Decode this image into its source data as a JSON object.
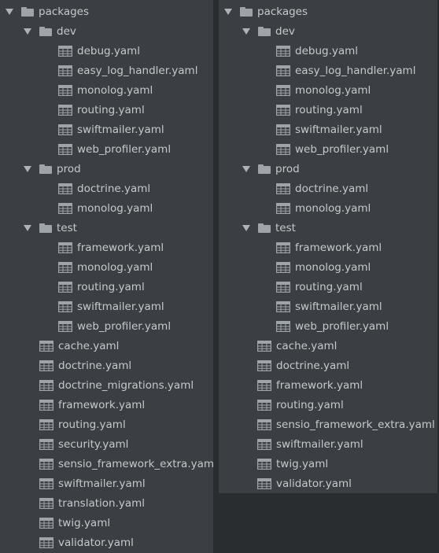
{
  "left_tree": [
    {
      "type": "folder",
      "depth": 0,
      "label": "packages"
    },
    {
      "type": "folder",
      "depth": 1,
      "label": "dev"
    },
    {
      "type": "file",
      "depth": 2,
      "label": "debug.yaml"
    },
    {
      "type": "file",
      "depth": 2,
      "label": "easy_log_handler.yaml"
    },
    {
      "type": "file",
      "depth": 2,
      "label": "monolog.yaml"
    },
    {
      "type": "file",
      "depth": 2,
      "label": "routing.yaml"
    },
    {
      "type": "file",
      "depth": 2,
      "label": "swiftmailer.yaml"
    },
    {
      "type": "file",
      "depth": 2,
      "label": "web_profiler.yaml"
    },
    {
      "type": "folder",
      "depth": 1,
      "label": "prod"
    },
    {
      "type": "file",
      "depth": 2,
      "label": "doctrine.yaml"
    },
    {
      "type": "file",
      "depth": 2,
      "label": "monolog.yaml"
    },
    {
      "type": "folder",
      "depth": 1,
      "label": "test"
    },
    {
      "type": "file",
      "depth": 2,
      "label": "framework.yaml"
    },
    {
      "type": "file",
      "depth": 2,
      "label": "monolog.yaml"
    },
    {
      "type": "file",
      "depth": 2,
      "label": "routing.yaml"
    },
    {
      "type": "file",
      "depth": 2,
      "label": "swiftmailer.yaml"
    },
    {
      "type": "file",
      "depth": 2,
      "label": "web_profiler.yaml"
    },
    {
      "type": "file",
      "depth": 1,
      "label": "cache.yaml"
    },
    {
      "type": "file",
      "depth": 1,
      "label": "doctrine.yaml"
    },
    {
      "type": "file",
      "depth": 1,
      "label": "doctrine_migrations.yaml"
    },
    {
      "type": "file",
      "depth": 1,
      "label": "framework.yaml"
    },
    {
      "type": "file",
      "depth": 1,
      "label": "routing.yaml"
    },
    {
      "type": "file",
      "depth": 1,
      "label": "security.yaml"
    },
    {
      "type": "file",
      "depth": 1,
      "label": "sensio_framework_extra.yaml"
    },
    {
      "type": "file",
      "depth": 1,
      "label": "swiftmailer.yaml"
    },
    {
      "type": "file",
      "depth": 1,
      "label": "translation.yaml"
    },
    {
      "type": "file",
      "depth": 1,
      "label": "twig.yaml"
    },
    {
      "type": "file",
      "depth": 1,
      "label": "validator.yaml"
    }
  ],
  "right_tree": [
    {
      "type": "folder",
      "depth": 0,
      "label": "packages"
    },
    {
      "type": "folder",
      "depth": 1,
      "label": "dev"
    },
    {
      "type": "file",
      "depth": 2,
      "label": "debug.yaml"
    },
    {
      "type": "file",
      "depth": 2,
      "label": "easy_log_handler.yaml"
    },
    {
      "type": "file",
      "depth": 2,
      "label": "monolog.yaml"
    },
    {
      "type": "file",
      "depth": 2,
      "label": "routing.yaml"
    },
    {
      "type": "file",
      "depth": 2,
      "label": "swiftmailer.yaml"
    },
    {
      "type": "file",
      "depth": 2,
      "label": "web_profiler.yaml"
    },
    {
      "type": "folder",
      "depth": 1,
      "label": "prod"
    },
    {
      "type": "file",
      "depth": 2,
      "label": "doctrine.yaml"
    },
    {
      "type": "file",
      "depth": 2,
      "label": "monolog.yaml"
    },
    {
      "type": "folder",
      "depth": 1,
      "label": "test"
    },
    {
      "type": "file",
      "depth": 2,
      "label": "framework.yaml"
    },
    {
      "type": "file",
      "depth": 2,
      "label": "monolog.yaml"
    },
    {
      "type": "file",
      "depth": 2,
      "label": "routing.yaml"
    },
    {
      "type": "file",
      "depth": 2,
      "label": "swiftmailer.yaml"
    },
    {
      "type": "file",
      "depth": 2,
      "label": "web_profiler.yaml"
    },
    {
      "type": "file",
      "depth": 1,
      "label": "cache.yaml"
    },
    {
      "type": "file",
      "depth": 1,
      "label": "doctrine.yaml"
    },
    {
      "type": "file",
      "depth": 1,
      "label": "framework.yaml"
    },
    {
      "type": "file",
      "depth": 1,
      "label": "routing.yaml"
    },
    {
      "type": "file",
      "depth": 1,
      "label": "sensio_framework_extra.yaml"
    },
    {
      "type": "file",
      "depth": 1,
      "label": "swiftmailer.yaml"
    },
    {
      "type": "file",
      "depth": 1,
      "label": "twig.yaml"
    },
    {
      "type": "file",
      "depth": 1,
      "label": "validator.yaml"
    }
  ],
  "icons": {
    "folder": "folder-icon",
    "file": "yaml-file-icon",
    "expand": "expanded-arrow-icon"
  },
  "colors": {
    "pane_bg": "#3b3f43",
    "background": "#2a2d30",
    "text": "#c6c9cc",
    "icon": "#9ea4aa"
  }
}
